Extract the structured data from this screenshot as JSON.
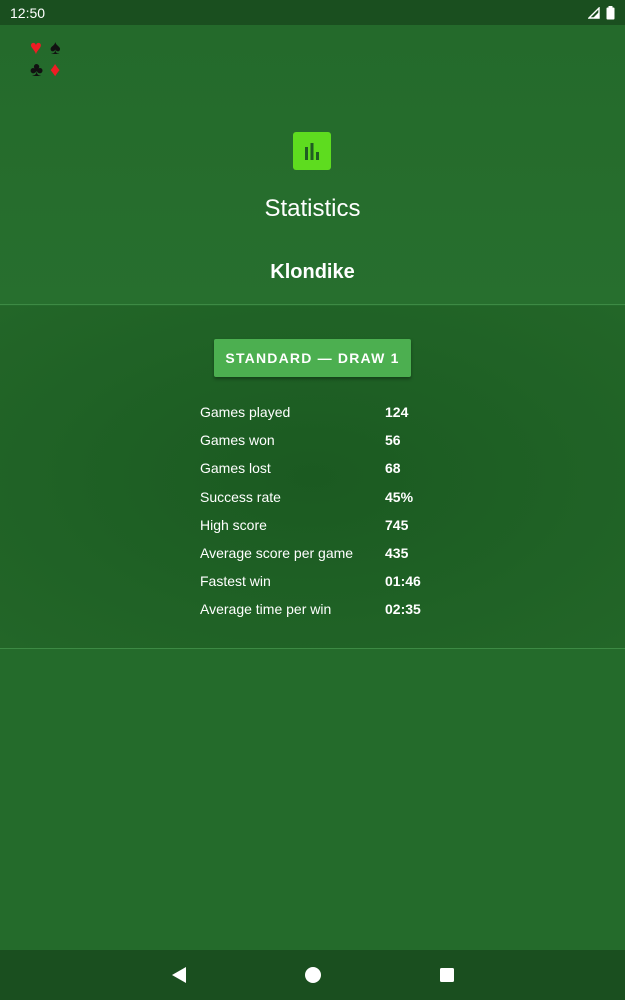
{
  "status_bar": {
    "time": "12:50",
    "icons": [
      "signal-icon",
      "battery-icon"
    ]
  },
  "header": {
    "suit_icons": [
      "heart-icon",
      "spade-icon",
      "club-icon",
      "diamond-icon"
    ],
    "title": "Statistics",
    "game_name": "Klondike",
    "icon": "bar-chart-icon",
    "icon_color": "#5edc1f"
  },
  "panel": {
    "mode_button_label": "STANDARD — DRAW 1",
    "stats": [
      {
        "label": "Games played",
        "value": "124"
      },
      {
        "label": "Games won",
        "value": "56"
      },
      {
        "label": "Games lost",
        "value": "68"
      },
      {
        "label": "Success rate",
        "value": "45%"
      },
      {
        "label": "High score",
        "value": "745"
      },
      {
        "label": "Average score per game",
        "value": "435"
      },
      {
        "label": "Fastest win",
        "value": "01:46"
      },
      {
        "label": "Average time per win",
        "value": "02:35"
      }
    ]
  },
  "nav_bar": {
    "icons": [
      "back-icon",
      "home-icon",
      "recents-icon"
    ]
  },
  "colors": {
    "background": "#246b2b",
    "accent_button": "#4caf50",
    "bars": "#1a4f1f"
  }
}
